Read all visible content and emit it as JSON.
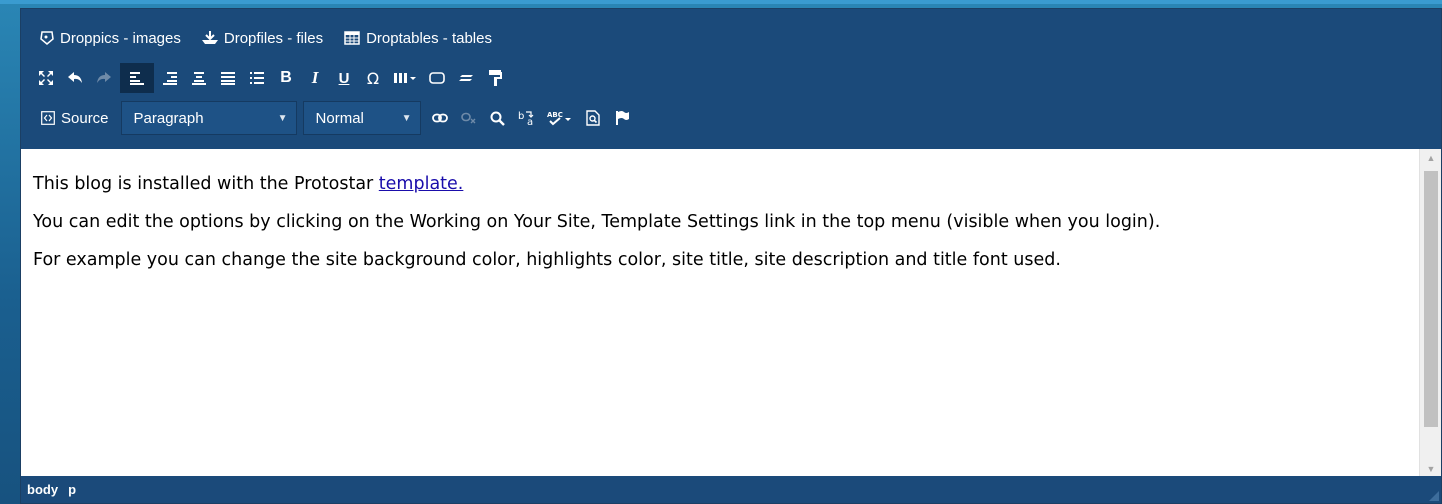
{
  "plugins": [
    {
      "label": "Droppics - images",
      "icon": "droppics-icon"
    },
    {
      "label": "Dropfiles - files",
      "icon": "dropfiles-icon"
    },
    {
      "label": "Droptables - tables",
      "icon": "droptables-icon"
    }
  ],
  "toolbar": {
    "source_label": "Source",
    "block_format": "Paragraph",
    "font_size": "Normal",
    "omega": "Ω"
  },
  "content": {
    "p1_text": "This blog is installed with the Protostar ",
    "p1_link": "template.",
    "p2": "You can edit the options by clicking on the Working on Your Site, Template Settings link in the top menu (visible when you login).",
    "p3": "For example you can change the site background color, highlights color, site title, site description and title font used."
  },
  "status": {
    "path": [
      "body",
      "p"
    ]
  },
  "colors": {
    "toolbar_bg": "#1b4a7a",
    "active_button": "#0e2d4d",
    "link": "#1a0dab"
  }
}
